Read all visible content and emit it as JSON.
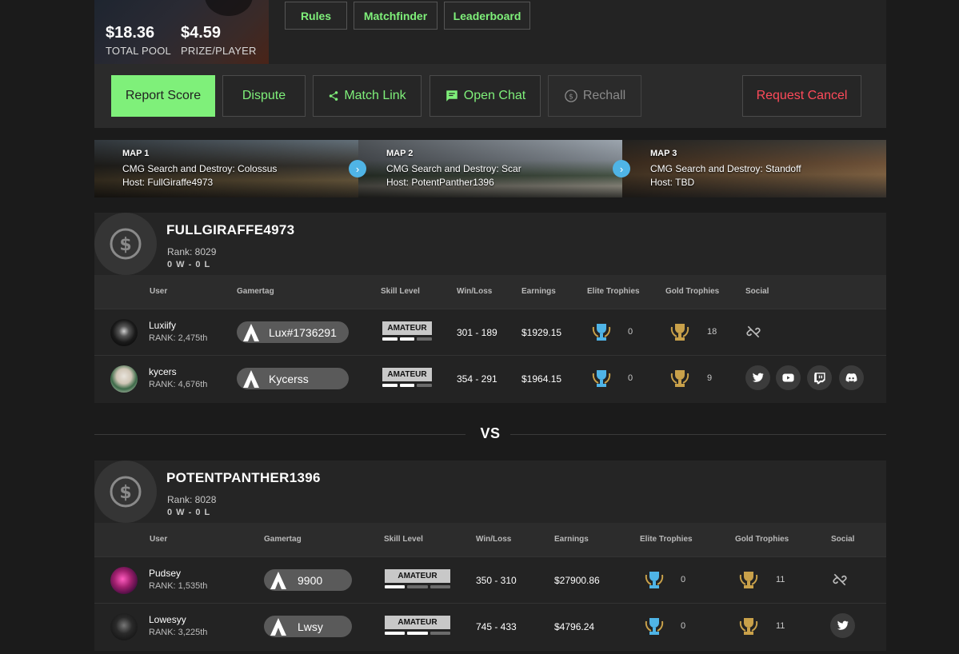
{
  "pool": {
    "total_value": "$18.36",
    "total_label": "TOTAL POOL",
    "prize_value": "$4.59",
    "prize_label": "PRIZE/PLAYER"
  },
  "nav": {
    "rules": "Rules",
    "matchfinder": "Matchfinder",
    "leaderboard": "Leaderboard"
  },
  "actions": {
    "report": "Report Score",
    "dispute": "Dispute",
    "match_link": "Match Link",
    "open_chat": "Open Chat",
    "rechall": "Rechall",
    "request_cancel": "Request Cancel"
  },
  "colors": {
    "accent_green": "#7ff07a",
    "cancel_red": "#ff4a5a",
    "report_bg": "#7ff07a",
    "map_arrow": "#4fb4e6"
  },
  "maps": [
    {
      "label": "MAP 1",
      "name": "CMG Search and Destroy: Colossus",
      "host": "Host: FullGiraffe4973"
    },
    {
      "label": "MAP 2",
      "name": "CMG Search and Destroy: Scar",
      "host": "Host: PotentPanther1396"
    },
    {
      "label": "MAP 3",
      "name": "CMG Search and Destroy: Standoff",
      "host": "Host: TBD"
    }
  ],
  "headers": [
    "User",
    "Gamertag",
    "Skill Level",
    "Win/Loss",
    "Earnings",
    "Elite Trophies",
    "Gold Trophies",
    "Social"
  ],
  "teams": [
    {
      "name": "FULLGIRAFFE4973",
      "rank": "Rank: 8029",
      "record": "0 W - 0 L",
      "players": [
        {
          "user": "Luxiify",
          "rank": "RANK: 2,475th",
          "gamertag": "Lux#1736291",
          "skill": "AMATEUR",
          "skill_level": 2,
          "winloss": "301 - 189",
          "earnings": "$1929.15",
          "elite": "0",
          "gold": "18",
          "social": [
            "unlinked-icon"
          ]
        },
        {
          "user": "kycers",
          "rank": "RANK: 4,676th",
          "gamertag": "Kycerss",
          "skill": "AMATEUR",
          "skill_level": 2,
          "winloss": "354 - 291",
          "earnings": "$1964.15",
          "elite": "0",
          "gold": "9",
          "social": [
            "twitter-icon",
            "youtube-icon",
            "twitch-icon",
            "discord-icon"
          ]
        }
      ]
    },
    {
      "name": "POTENTPANTHER1396",
      "rank": "Rank: 8028",
      "record": "0 W - 0 L",
      "players": [
        {
          "user": "Pudsey",
          "rank": "RANK: 1,535th",
          "gamertag": "9900",
          "skill": "AMATEUR",
          "skill_level": 1,
          "winloss": "350 - 310",
          "earnings": "$27900.86",
          "elite": "0",
          "gold": "11",
          "social": [
            "unlinked-icon"
          ]
        },
        {
          "user": "Lowesyy",
          "rank": "RANK: 3,225th",
          "gamertag": "Lwsy",
          "skill": "AMATEUR",
          "skill_level": 2,
          "winloss": "745 - 433",
          "earnings": "$4796.24",
          "elite": "0",
          "gold": "11",
          "social": [
            "twitter-icon"
          ]
        }
      ]
    }
  ],
  "vs": "VS"
}
